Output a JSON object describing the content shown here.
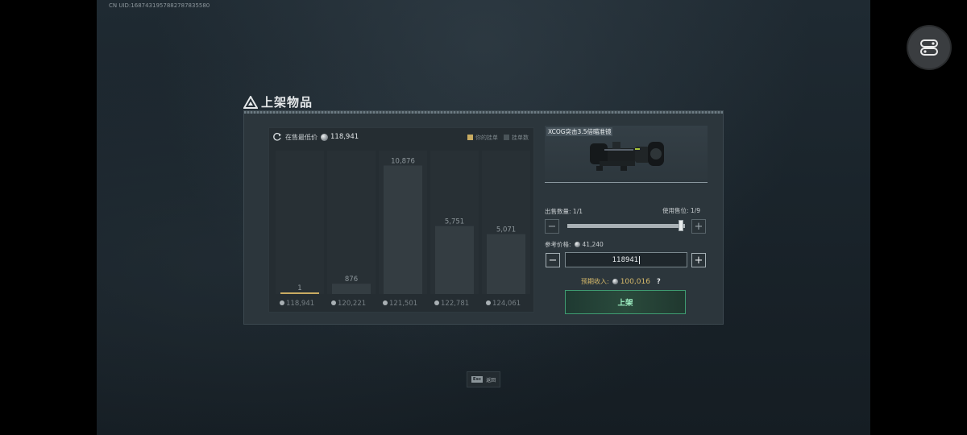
{
  "uid_text": "CN UID:1687431957882787835580",
  "dialog": {
    "title": "上架物品",
    "lowest_price_label": "在售最低价",
    "lowest_price_value": "118,941",
    "legend": [
      {
        "label": "你的挂单",
        "color": "#c8ab62"
      },
      {
        "label": "挂单数",
        "color": "#4a5459"
      }
    ]
  },
  "chart_data": {
    "type": "bar",
    "categories": [
      "118,941",
      "120,221",
      "121,501",
      "122,781",
      "124,061"
    ],
    "values": [
      1,
      876,
      10876,
      5751,
      5071
    ],
    "value_labels": [
      "1",
      "876",
      "10,876",
      "5,751",
      "5,071"
    ],
    "highlight_index": 0,
    "highlight_color": "#c8ab62",
    "bar_color": "#343d42",
    "ylim": [
      0,
      12000
    ]
  },
  "item": {
    "name": "XCOG突击3.5倍瞄准镜"
  },
  "sell": {
    "quantity_label": "出售数量:",
    "quantity_value": "1/1",
    "slots_label": "使用售位:",
    "slots_value": "1/9",
    "quantity_fraction": 1.0,
    "minus": "−",
    "plus": "+",
    "ref_price_label": "参考价格:",
    "ref_price_value": "41,240",
    "price_input_value": "118941",
    "income_label": "预期收入:",
    "income_value": "100,016",
    "help": "?",
    "list_button": "上架"
  },
  "footer": {
    "esc_key": "Esc",
    "back_label": "返回"
  }
}
